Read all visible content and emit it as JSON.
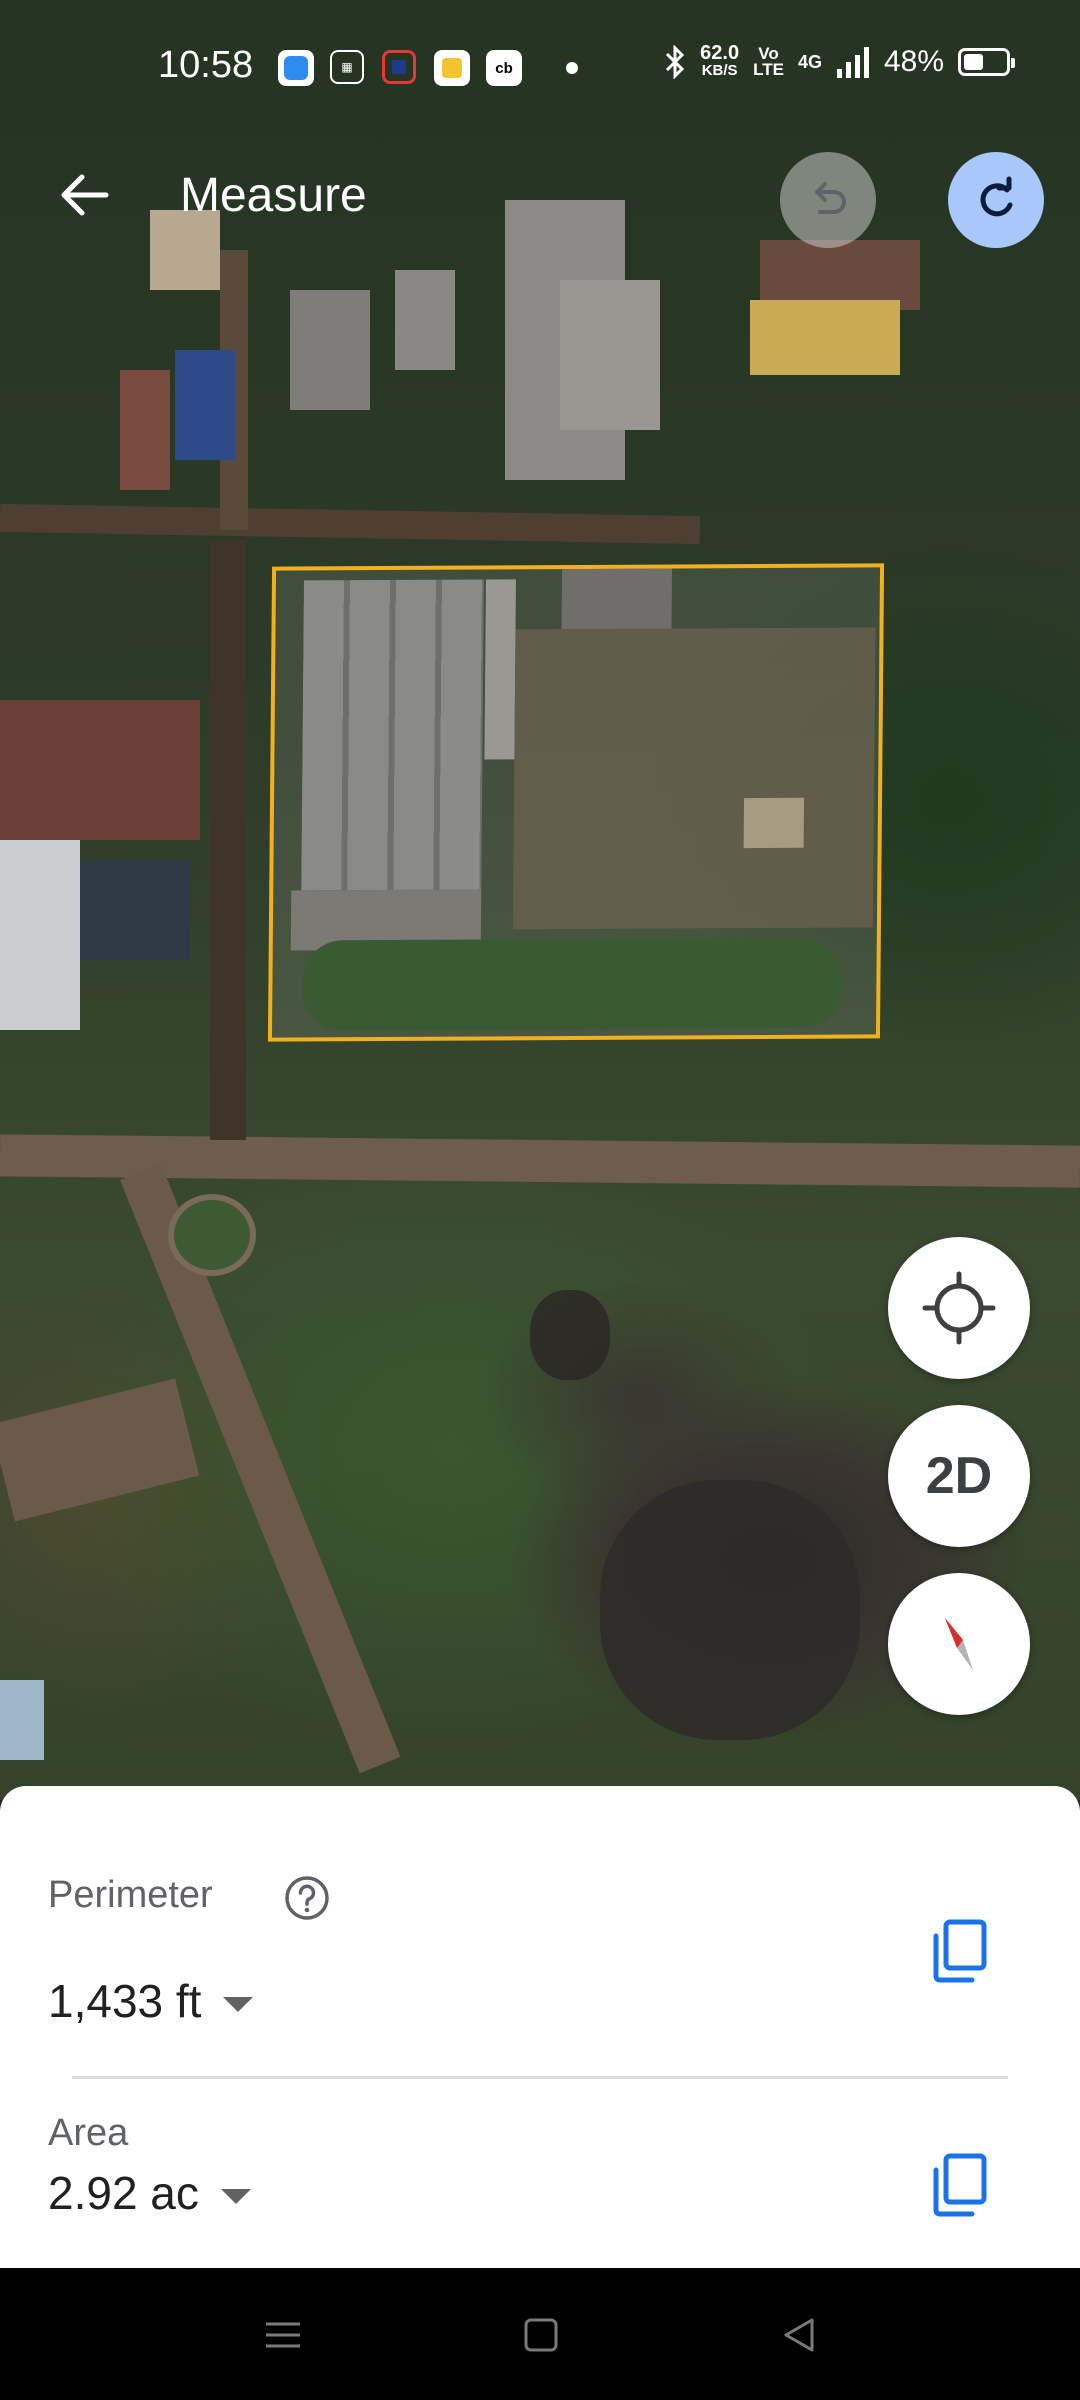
{
  "status_bar": {
    "time": "10:58",
    "speed_value": "62.0",
    "speed_unit": "KB/S",
    "volte_top": "Vo",
    "volte_bottom": "LTE",
    "network": "4G",
    "battery_percent": "48%",
    "battery_level": 0.48,
    "notification_icons": [
      "app-icon-blue",
      "calculator-icon",
      "app-icon-red",
      "app-icon-yellow-r",
      "app-icon-cb",
      "dot-icon"
    ]
  },
  "header": {
    "title": "Measure"
  },
  "map": {
    "fab_2d_label": "2D"
  },
  "measurements": {
    "perimeter_label": "Perimeter",
    "perimeter_value": "1,433 ft",
    "area_label": "Area",
    "area_value": "2.92 ac"
  },
  "colors": {
    "outline": "#f2b01e",
    "redo_bg": "#a8c7fa",
    "accent_blue": "#1a73e8"
  }
}
